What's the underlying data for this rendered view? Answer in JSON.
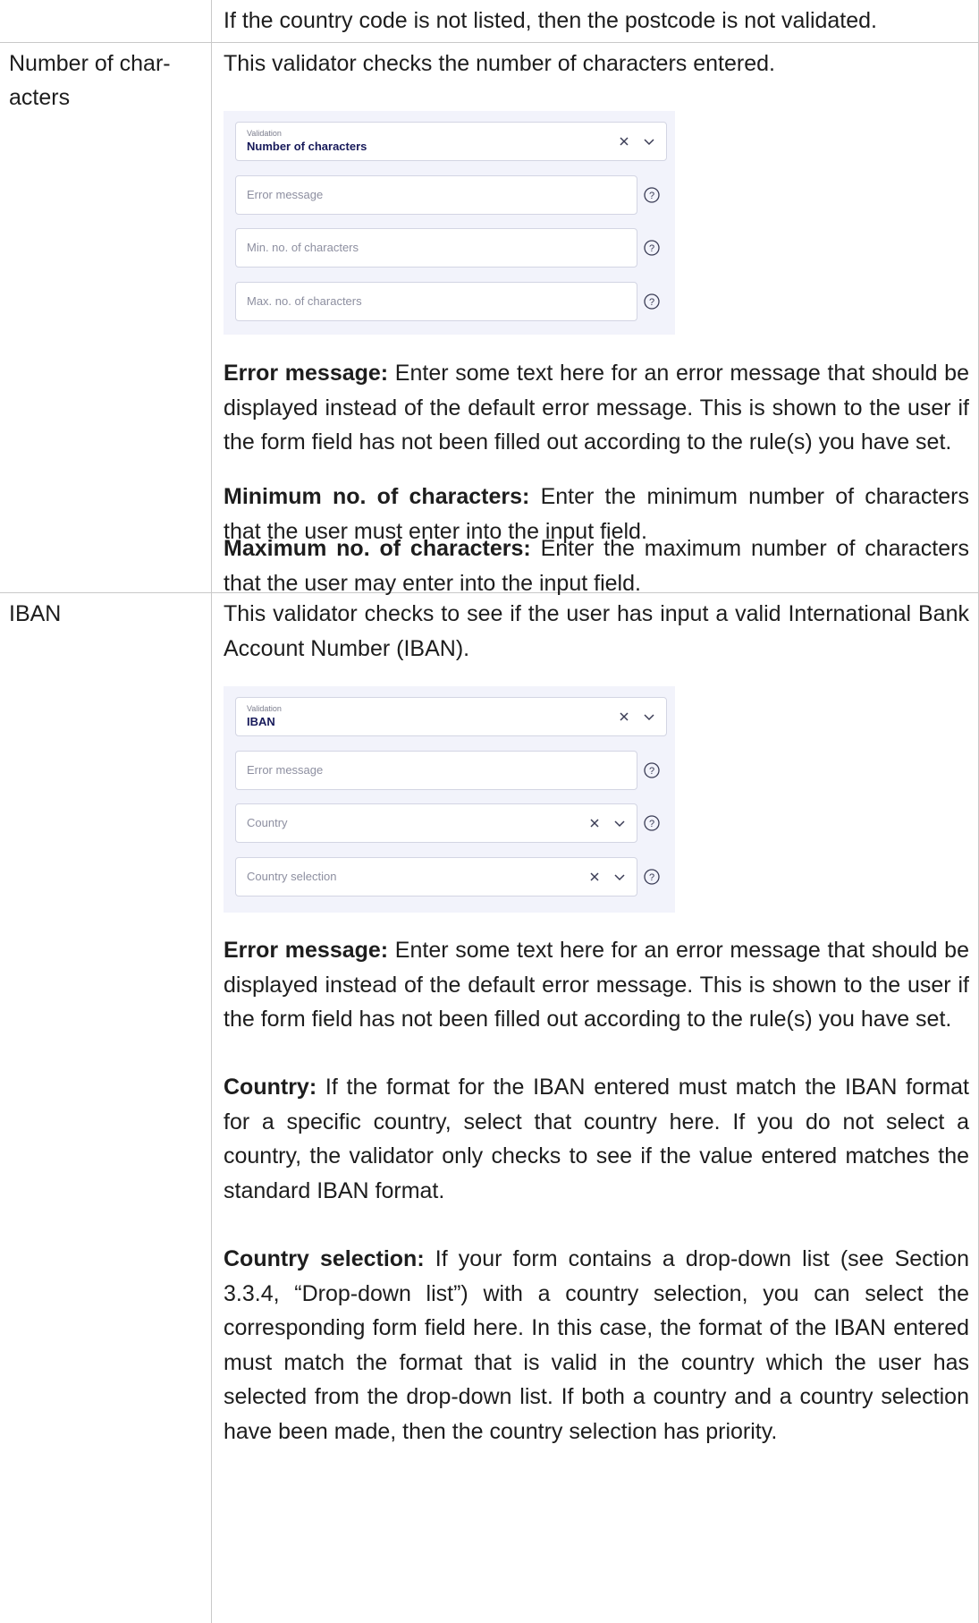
{
  "rows": {
    "postcode": {
      "text": "If the country code is not listed, then the postcode is not validated."
    },
    "num_chars": {
      "name_line1": "Number of char-",
      "name_line2": "acters",
      "intro": "This validator checks the number of characters entered.",
      "panel": {
        "validation_label": "Validation",
        "validation_value": "Number of characters",
        "error_placeholder": "Error message",
        "min_placeholder": "Min. no. of characters",
        "max_placeholder": "Max. no. of characters"
      },
      "p1_bold": "Error message:",
      "p1_text": " Enter some text here for an error message that should be displayed instead of the default error message. This is shown to the user if the form field has not been filled out according to the rule(s) you have set.",
      "p2_bold": "Minimum no. of characters:",
      "p2_text": " Enter the minimum number of characters that the user must enter into the input field.",
      "p3_bold": "Maximum no. of characters:",
      "p3_text": " Enter the maximum number of characters that the user may enter into the input field."
    },
    "iban": {
      "name": "IBAN",
      "intro": "This validator checks to see if the user has input a valid International Bank Account Number (IBAN).",
      "panel": {
        "validation_label": "Validation",
        "validation_value": "IBAN",
        "error_placeholder": "Error message",
        "country_placeholder": "Country",
        "country_selection_placeholder": "Country selection"
      },
      "p1_bold": "Error message:",
      "p1_text": " Enter some text here for an error message that should be displayed instead of the default error message. This is shown to the user if the form field has not been filled out according to the rule(s) you have set.",
      "p2_bold": "Country:",
      "p2_text": " If the format for the IBAN entered must match the IBAN format for a specific country, select that country here. If you do not select a country, the validator only checks to see if the value entered matches the standard IBAN format.",
      "p3_bold": "Country selection:",
      "p3_text": " If your form contains a drop-down list (see Section 3.3.4, “Drop-down list”) with a country selection, you can select the corresponding form field here. In this case, the format of the IBAN entered must match the format that is valid in the country which the user has selected from the drop-down list. If both a country and a country selection have been made, then the country selection has priority."
    }
  },
  "colors": {
    "panel_bg": "#f2f3fb",
    "value_text": "#171a5a",
    "border": "#c9c9c9"
  },
  "icons": {
    "clear": "close-icon",
    "dropdown": "chevron-down-icon",
    "help": "help-circle-icon"
  }
}
